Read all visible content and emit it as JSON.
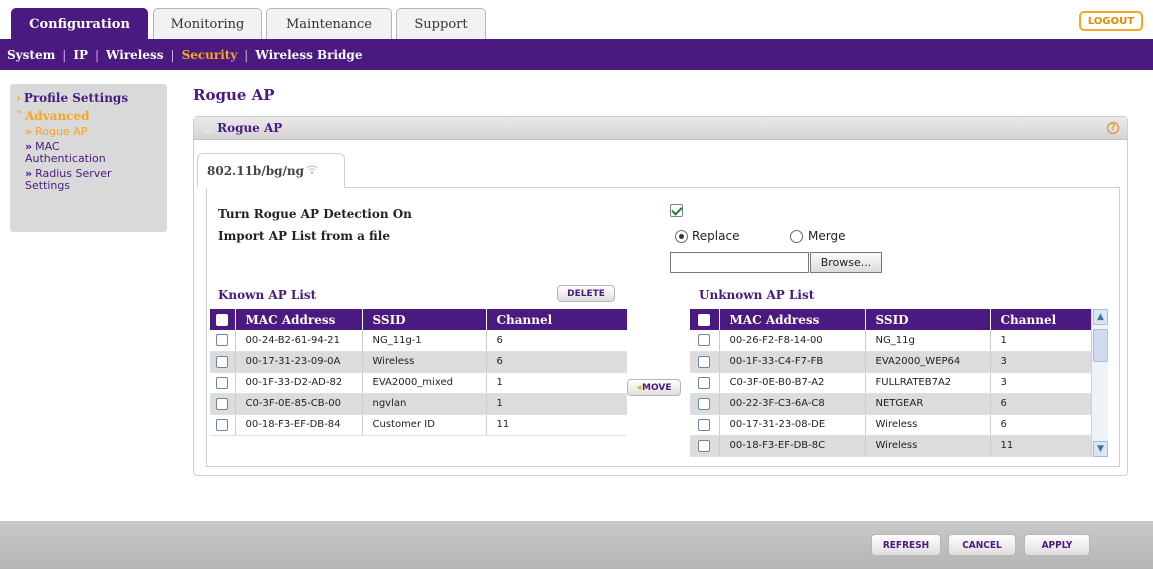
{
  "tabs": [
    {
      "label": "Configuration",
      "active": true
    },
    {
      "label": "Monitoring",
      "active": false
    },
    {
      "label": "Maintenance",
      "active": false
    },
    {
      "label": "Support",
      "active": false
    }
  ],
  "logout_label": "LOGOUT",
  "subnav": {
    "items": [
      "System",
      "IP",
      "Wireless",
      "Security",
      "Wireless Bridge"
    ],
    "active": "Security"
  },
  "sidebar": {
    "profile_settings": "Profile Settings",
    "advanced": "Advanced",
    "rogue_ap": "Rogue AP",
    "mac_auth_line1": "MAC",
    "mac_auth_line2": "Authentication",
    "radius_line1": "Radius Server",
    "radius_line2": "Settings"
  },
  "page_title": "Rogue AP",
  "panel": {
    "title": "Rogue AP",
    "help_icon": "?",
    "band_tab": "802.11b/bg/ng"
  },
  "form": {
    "detection_label": "Turn Rogue AP Detection On",
    "detection_checked": true,
    "import_label": "Import AP List from a file",
    "replace_label": "Replace",
    "merge_label": "Merge",
    "selected_mode": "Replace",
    "file_value": "",
    "browse_label": "Browse..."
  },
  "known_list": {
    "title": "Known AP List",
    "delete_label": "DELETE",
    "headers": [
      "MAC Address",
      "SSID",
      "Channel"
    ],
    "rows": [
      {
        "mac": "00-24-B2-61-94-21",
        "ssid": "NG_11g-1",
        "channel": "6"
      },
      {
        "mac": "00-17-31-23-09-0A",
        "ssid": "Wireless",
        "channel": "6"
      },
      {
        "mac": "00-1F-33-D2-AD-82",
        "ssid": "EVA2000_mixed",
        "channel": "1"
      },
      {
        "mac": "C0-3F-0E-85-CB-00",
        "ssid": "ngvlan",
        "channel": "1"
      },
      {
        "mac": "00-18-F3-EF-DB-84",
        "ssid": "Customer ID",
        "channel": "11"
      }
    ]
  },
  "move_label": "MOVE",
  "unknown_list": {
    "title": "Unknown AP List",
    "headers": [
      "MAC Address",
      "SSID",
      "Channel"
    ],
    "rows": [
      {
        "mac": "00-26-F2-F8-14-00",
        "ssid": "NG_11g",
        "channel": "1"
      },
      {
        "mac": "00-1F-33-C4-F7-FB",
        "ssid": "EVA2000_WEP64",
        "channel": "3"
      },
      {
        "mac": "C0-3F-0E-B0-B7-A2",
        "ssid": "FULLRATEB7A2",
        "channel": "3"
      },
      {
        "mac": "00-22-3F-C3-6A-C8",
        "ssid": "NETGEAR",
        "channel": "6"
      },
      {
        "mac": "00-17-31-23-08-DE",
        "ssid": "Wireless",
        "channel": "6"
      },
      {
        "mac": "00-18-F3-EF-DB-8C",
        "ssid": "Wireless",
        "channel": "11"
      }
    ]
  },
  "footer": {
    "refresh": "REFRESH",
    "cancel": "CANCEL",
    "apply": "APPLY"
  },
  "colors": {
    "brand_purple": "#4a1a80",
    "accent_orange": "#f5a623"
  }
}
